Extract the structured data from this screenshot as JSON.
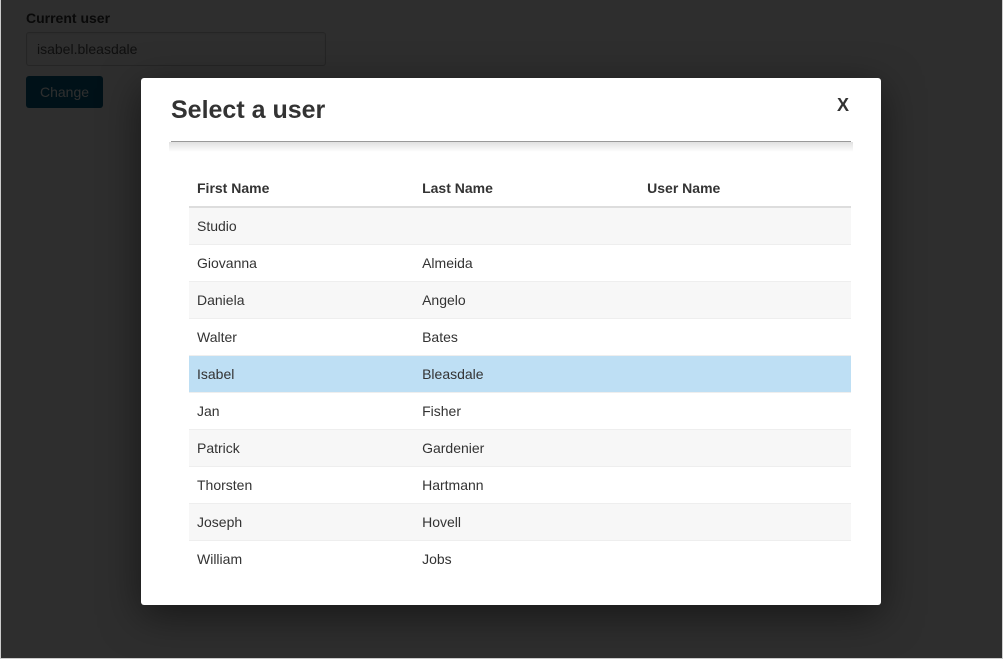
{
  "background": {
    "label": "Current user",
    "input_value": "isabel.bleasdale",
    "change_button": "Change"
  },
  "modal": {
    "title": "Select a user",
    "close_label": "X",
    "columns": {
      "first_name": "First Name",
      "last_name": "Last Name",
      "user_name": "User Name"
    },
    "rows": [
      {
        "first": "Studio",
        "last": "",
        "user": "",
        "selected": false
      },
      {
        "first": "Giovanna",
        "last": "Almeida",
        "user": "",
        "selected": false
      },
      {
        "first": "Daniela",
        "last": "Angelo",
        "user": "",
        "selected": false
      },
      {
        "first": "Walter",
        "last": "Bates",
        "user": "",
        "selected": false
      },
      {
        "first": "Isabel",
        "last": "Bleasdale",
        "user": "",
        "selected": true
      },
      {
        "first": "Jan",
        "last": "Fisher",
        "user": "",
        "selected": false
      },
      {
        "first": "Patrick",
        "last": "Gardenier",
        "user": "",
        "selected": false
      },
      {
        "first": "Thorsten",
        "last": "Hartmann",
        "user": "",
        "selected": false
      },
      {
        "first": "Joseph",
        "last": "Hovell",
        "user": "",
        "selected": false
      },
      {
        "first": "William",
        "last": "Jobs",
        "user": "",
        "selected": false
      }
    ]
  }
}
